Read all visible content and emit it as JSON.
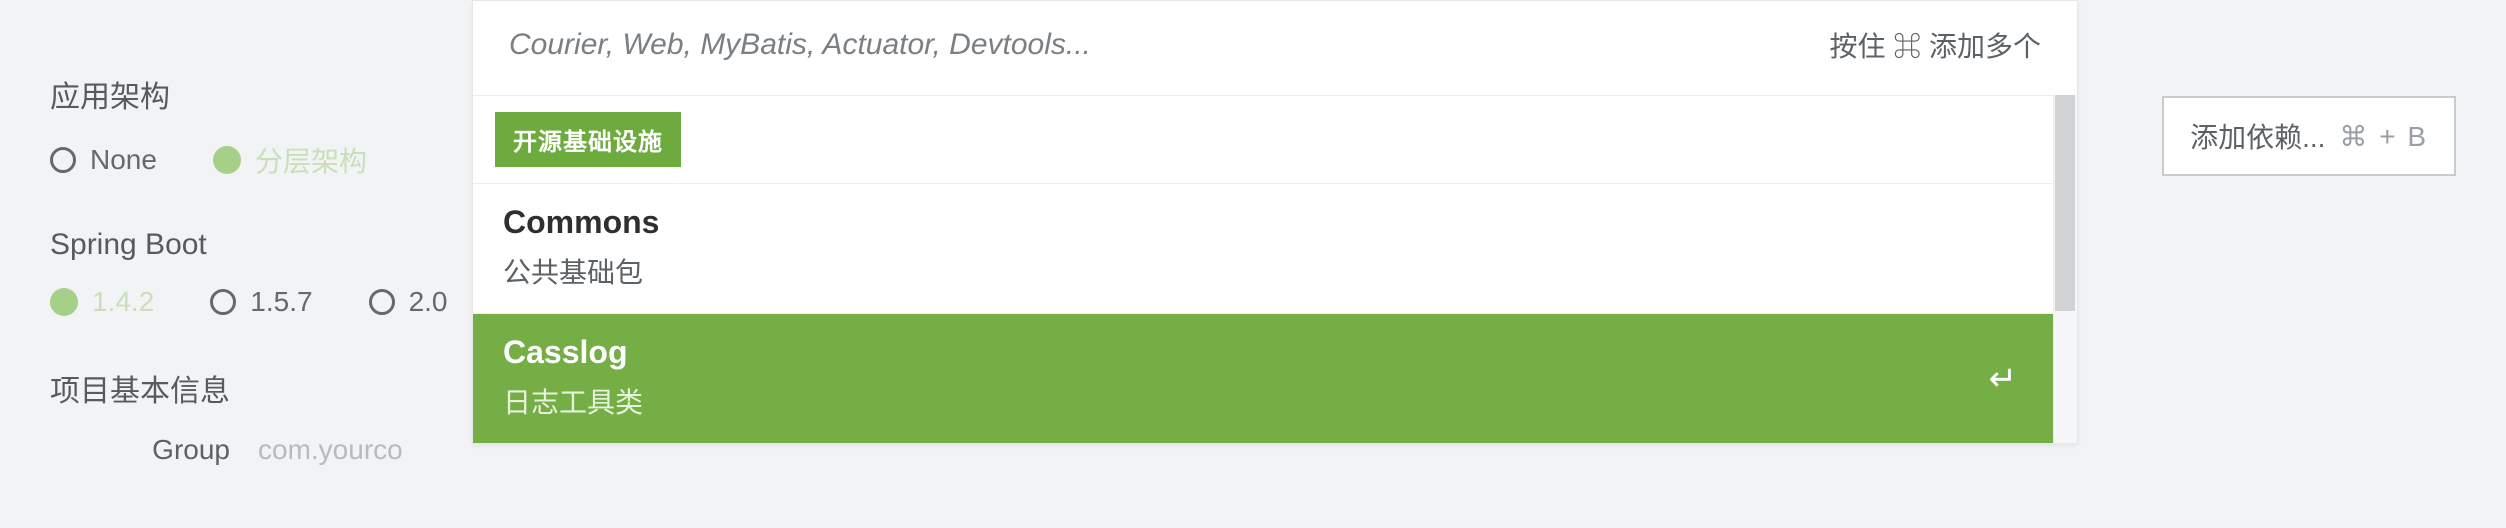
{
  "sidebar": {
    "arch": {
      "title": "应用架构",
      "options": [
        "None",
        "分层架构"
      ],
      "selected": 1
    },
    "springBoot": {
      "title": "Spring Boot",
      "options": [
        "1.4.2",
        "1.5.7",
        "2.0"
      ],
      "selected": 0
    },
    "projectInfo": {
      "title": "项目基本信息",
      "groupLabel": "Group",
      "groupValue": "com.yourco"
    }
  },
  "dropdown": {
    "placeholder": "Courier, Web, MyBatis, Actuator, Devtools...",
    "hint": "按住 ⌘ 添加多个",
    "groupBadge": "开源基础设施",
    "items": [
      {
        "title": "Commons",
        "desc": "公共基础包",
        "selected": false
      },
      {
        "title": "Casslog",
        "desc": "日志工具类",
        "selected": true
      }
    ]
  },
  "addButton": {
    "label": "添加依赖...",
    "shortcut": "⌘ + B"
  }
}
